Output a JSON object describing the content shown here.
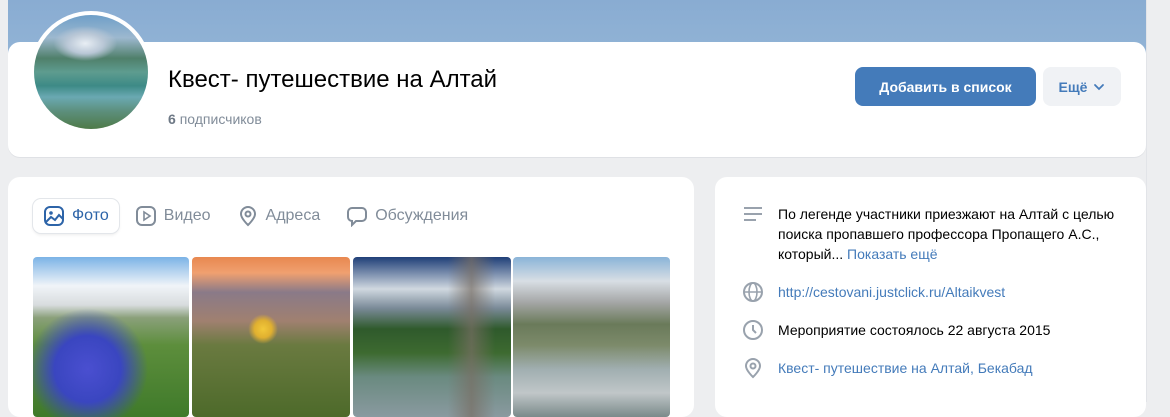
{
  "header": {
    "title": "Квест- путешествие на Алтай",
    "subscribers_count": "6",
    "subscribers_label": "подписчиков",
    "add_button": "Добавить в список",
    "more_button": "Ещё"
  },
  "tabs": [
    {
      "label": "Фото",
      "icon": "image-icon",
      "active": true
    },
    {
      "label": "Видео",
      "icon": "video-icon"
    },
    {
      "label": "Адреса",
      "icon": "location-icon"
    },
    {
      "label": "Обсуждения",
      "icon": "chat-icon"
    }
  ],
  "info": {
    "description": "По легенде участники приезжают на Алтай с целью поиска пропавшего профессора Пропащего А.С., который...",
    "show_more": "Показать ещё",
    "website": "http://cestovani.justclick.ru/Altaikvest",
    "date": "Мероприятие состоялось 22 августа 2015",
    "address": "Квест- путешествие на Алтай, Бекабад"
  },
  "colors": {
    "accent": "#447bba",
    "cover": "#8eb1d4",
    "background": "#edeef0"
  }
}
